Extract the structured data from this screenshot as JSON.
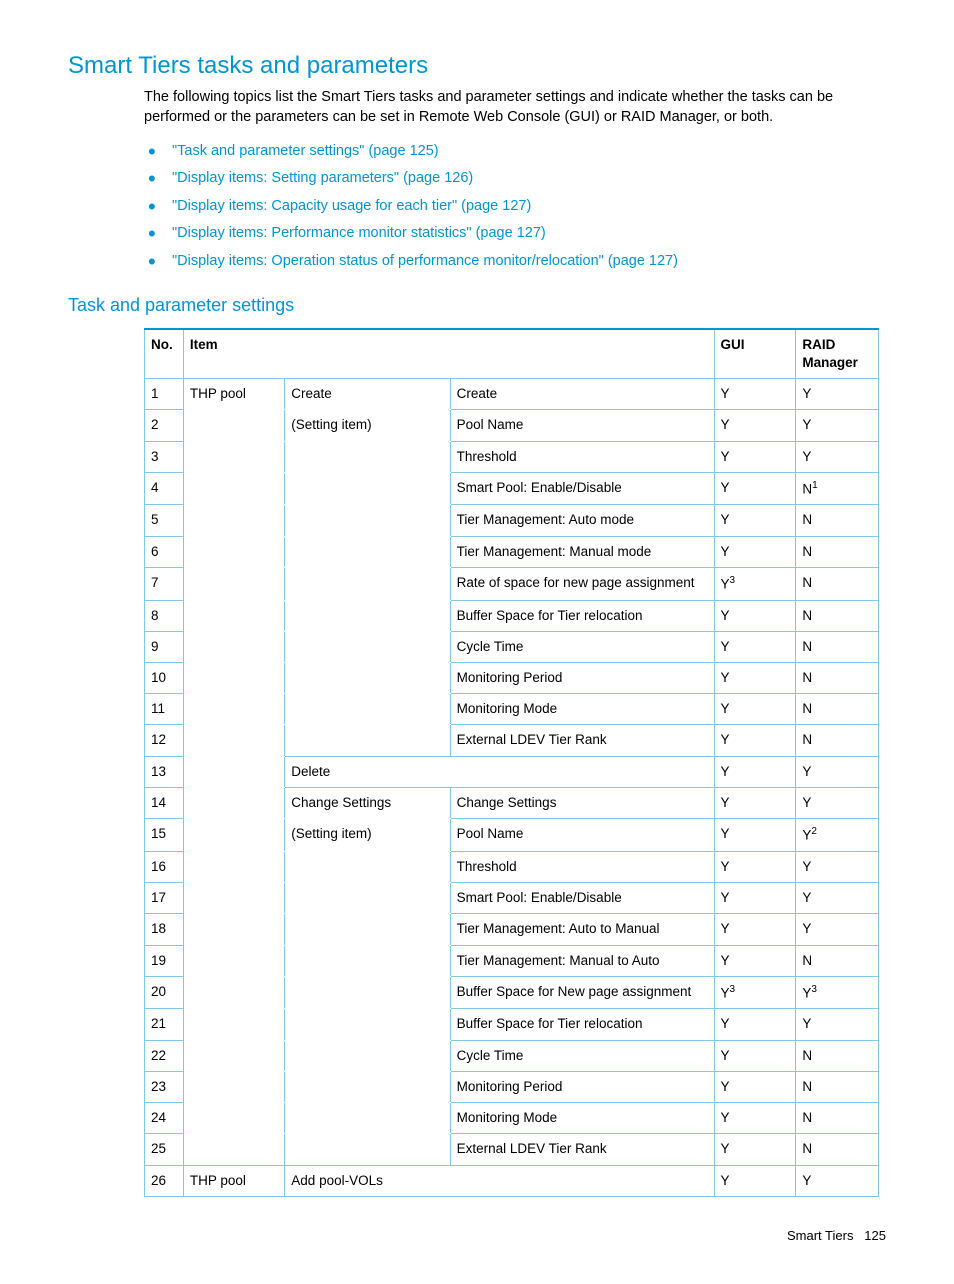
{
  "title": "Smart Tiers tasks and parameters",
  "intro": "The following topics list the Smart Tiers tasks and parameter settings and indicate whether the tasks can be performed or the parameters can be set in Remote Web Console (GUI) or RAID Manager, or both.",
  "links": [
    "\"Task and parameter settings\" (page 125)",
    "\"Display items: Setting parameters\" (page 126)",
    "\"Display items: Capacity usage for each tier\" (page 127)",
    "\"Display items: Performance monitor statistics\" (page 127)",
    "\"Display items: Operation status of performance monitor/relocation\" (page 127)"
  ],
  "subtitle": "Task and parameter settings",
  "headers": {
    "no": "No.",
    "item": "Item",
    "gui": "GUI",
    "raid": "RAID Manager"
  },
  "rows": {
    "r1": {
      "no": "1",
      "item1": "THP pool",
      "item2": "Create",
      "item2b": "(Setting item)",
      "item3": "Create",
      "gui": "Y",
      "raid": "Y"
    },
    "r2": {
      "no": "2",
      "item3": "Pool Name",
      "gui": "Y",
      "raid": "Y"
    },
    "r3": {
      "no": "3",
      "item3": "Threshold",
      "gui": "Y",
      "raid": "Y"
    },
    "r4": {
      "no": "4",
      "item3": "Smart Pool: Enable/Disable",
      "gui": "Y",
      "raid": "N",
      "raidSup": "1"
    },
    "r5": {
      "no": "5",
      "item3": "Tier Management: Auto mode",
      "gui": "Y",
      "raid": "N"
    },
    "r6": {
      "no": "6",
      "item3": "Tier Management: Manual mode",
      "gui": "Y",
      "raid": "N"
    },
    "r7": {
      "no": "7",
      "item3": "Rate of space for new page assignment",
      "gui": "Y",
      "guiSup": "3",
      "raid": "N"
    },
    "r8": {
      "no": "8",
      "item3": "Buffer Space for Tier relocation",
      "gui": "Y",
      "raid": "N"
    },
    "r9": {
      "no": "9",
      "item3": "Cycle Time",
      "gui": "Y",
      "raid": "N"
    },
    "r10": {
      "no": "10",
      "item3": "Monitoring Period",
      "gui": "Y",
      "raid": "N"
    },
    "r11": {
      "no": "11",
      "item3": "Monitoring Mode",
      "gui": "Y",
      "raid": "N"
    },
    "r12": {
      "no": "12",
      "item3": "External LDEV Tier Rank",
      "gui": "Y",
      "raid": "N"
    },
    "r13": {
      "no": "13",
      "item2": "Delete",
      "gui": "Y",
      "raid": "Y"
    },
    "r14": {
      "no": "14",
      "item2": "Change Settings",
      "item2b": "(Setting item)",
      "item3": "Change Settings",
      "gui": "Y",
      "raid": "Y"
    },
    "r15": {
      "no": "15",
      "item3": "Pool Name",
      "gui": "Y",
      "raid": "Y",
      "raidSup": "2"
    },
    "r16": {
      "no": "16",
      "item3": "Threshold",
      "gui": "Y",
      "raid": "Y"
    },
    "r17": {
      "no": "17",
      "item3": "Smart Pool: Enable/Disable",
      "gui": "Y",
      "raid": "Y"
    },
    "r18": {
      "no": "18",
      "item3": "Tier Management: Auto to Manual",
      "gui": "Y",
      "raid": "Y"
    },
    "r19": {
      "no": "19",
      "item3": "Tier Management: Manual to Auto",
      "gui": "Y",
      "raid": "N"
    },
    "r20": {
      "no": "20",
      "item3": "Buffer Space for New page assignment",
      "gui": "Y",
      "guiSup": "3",
      "raid": "Y",
      "raidSup": "3"
    },
    "r21": {
      "no": "21",
      "item3": "Buffer Space for Tier relocation",
      "gui": "Y",
      "raid": "Y"
    },
    "r22": {
      "no": "22",
      "item3": "Cycle Time",
      "gui": "Y",
      "raid": "N"
    },
    "r23": {
      "no": "23",
      "item3": "Monitoring Period",
      "gui": "Y",
      "raid": "N"
    },
    "r24": {
      "no": "24",
      "item3": "Monitoring Mode",
      "gui": "Y",
      "raid": "N"
    },
    "r25": {
      "no": "25",
      "item3": "External LDEV Tier Rank",
      "gui": "Y",
      "raid": "N"
    },
    "r26": {
      "no": "26",
      "item1": "THP pool",
      "item2": "Add pool-VOLs",
      "gui": "Y",
      "raid": "Y"
    }
  },
  "footer": {
    "label": "Smart Tiers",
    "page": "125"
  }
}
